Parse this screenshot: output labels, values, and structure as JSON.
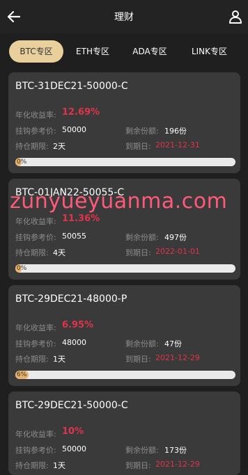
{
  "header": {
    "title": "理财"
  },
  "tabs": [
    "BTC专区",
    "ETH专区",
    "ADA专区",
    "LINK专区"
  ],
  "labels": {
    "rate": "年化收益率:",
    "ref_price": "挂钩参考价:",
    "remaining": "剩余份额:",
    "hold": "持仓期限:",
    "due": "到期日:"
  },
  "cards": [
    {
      "title": "BTC-31DEC21-50000-C",
      "rate": "12.69%",
      "ref_price": "50000",
      "remaining": "196份",
      "hold": "2天",
      "due": "2021-12-31",
      "progress_text": "0%",
      "progress": 0.03
    },
    {
      "title": "BTC-01JAN22-50055-C",
      "rate": "11.36%",
      "ref_price": "50055",
      "remaining": "497份",
      "hold": "4天",
      "due": "2022-01-01",
      "progress_text": "0%",
      "progress": 0.03
    },
    {
      "title": "BTC-29DEC21-48000-P",
      "rate": "6.95%",
      "ref_price": "48000",
      "remaining": "47份",
      "hold": "1天",
      "due": "2021-12-29",
      "progress_text": "6%",
      "progress": 0.06
    },
    {
      "title": "BTC-29DEC21-50000-C",
      "rate": "10%",
      "ref_price": "50000",
      "remaining": "173份",
      "hold": "1天",
      "due": "2021-12-29"
    }
  ],
  "watermark": "zunyueyuanma.com",
  "colors": {
    "accent": "#e9cf9c",
    "rate_red": "#e0334c",
    "card_bg": "#3a3a3a",
    "page_bg": "#1f1f1f"
  },
  "icons": {
    "back": "arrow-left-icon",
    "user": "user-icon"
  }
}
